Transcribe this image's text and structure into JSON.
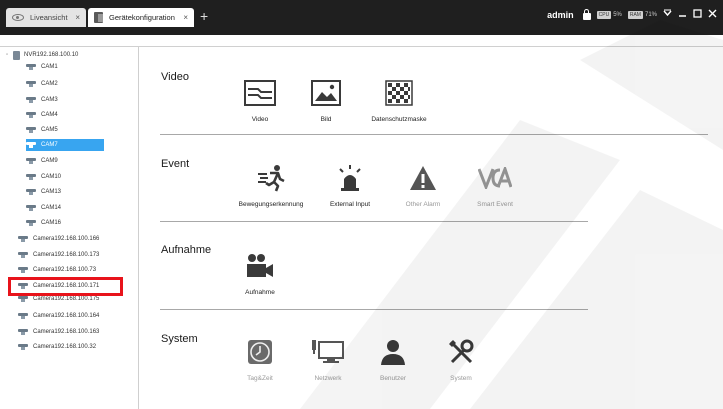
{
  "tabs": [
    {
      "label": "Liveansicht",
      "close": "×",
      "icon": "eye-icon"
    },
    {
      "label": "Gerätekonfiguration",
      "close": "×",
      "icon": "device-config-icon"
    }
  ],
  "new_tab": "+",
  "header": {
    "user": "admin",
    "cpu_chip": "CPU",
    "cpu_value": "5%",
    "ram_chip": "RAM",
    "ram_value": "71%"
  },
  "tree": {
    "nvr": "NVR192.168.100.10",
    "items": [
      {
        "label": "CAM1"
      },
      {
        "label": "CAM2"
      },
      {
        "label": "CAM3"
      },
      {
        "label": "CAM4"
      },
      {
        "label": "CAM5"
      },
      {
        "label": "CAM7",
        "selected": true
      },
      {
        "label": "CAM9"
      },
      {
        "label": "CAM10"
      },
      {
        "label": "CAM13"
      },
      {
        "label": "CAM14"
      },
      {
        "label": "CAM16"
      }
    ],
    "cameras": [
      {
        "label": "Camera192.168.100.166"
      },
      {
        "label": "Camera192.168.100.173"
      },
      {
        "label": "Camera192.168.100.73"
      },
      {
        "label": "Camera192.168.100.171"
      },
      {
        "label": "Camera192.168.100.175"
      },
      {
        "label": "Camera192.168.100.164"
      },
      {
        "label": "Camera192.168.100.163"
      },
      {
        "label": "Camera192.168.100.32"
      }
    ]
  },
  "sections": {
    "video": {
      "title": "Video",
      "tiles": [
        {
          "label": "Video",
          "icon": "video-settings-icon"
        },
        {
          "label": "Bild",
          "icon": "image-icon"
        },
        {
          "label": "Datenschutzmaske",
          "icon": "privacy-mask-icon"
        }
      ]
    },
    "event": {
      "title": "Event",
      "tiles": [
        {
          "label": "Bewegungserkennung",
          "icon": "motion-detection-icon"
        },
        {
          "label": "External Input",
          "icon": "alarm-light-icon"
        },
        {
          "label": "Other Alarm",
          "icon": "warning-icon"
        },
        {
          "label": "Smart Event",
          "icon": "vca-icon"
        }
      ]
    },
    "aufnahme": {
      "title": "Aufnahme",
      "tiles": [
        {
          "label": "Aufnahme",
          "icon": "recording-camera-icon"
        }
      ]
    },
    "system": {
      "title": "System",
      "tiles": [
        {
          "label": "Tag&Zeit",
          "icon": "clock-icon"
        },
        {
          "label": "Netzwerk",
          "icon": "network-icon"
        },
        {
          "label": "Benutzer",
          "icon": "user-icon"
        },
        {
          "label": "System",
          "icon": "tools-icon"
        }
      ]
    }
  },
  "colors": {
    "titlebar": "#1f1f1f",
    "selected": "#38a5f0",
    "highlight": "#e8131b"
  }
}
